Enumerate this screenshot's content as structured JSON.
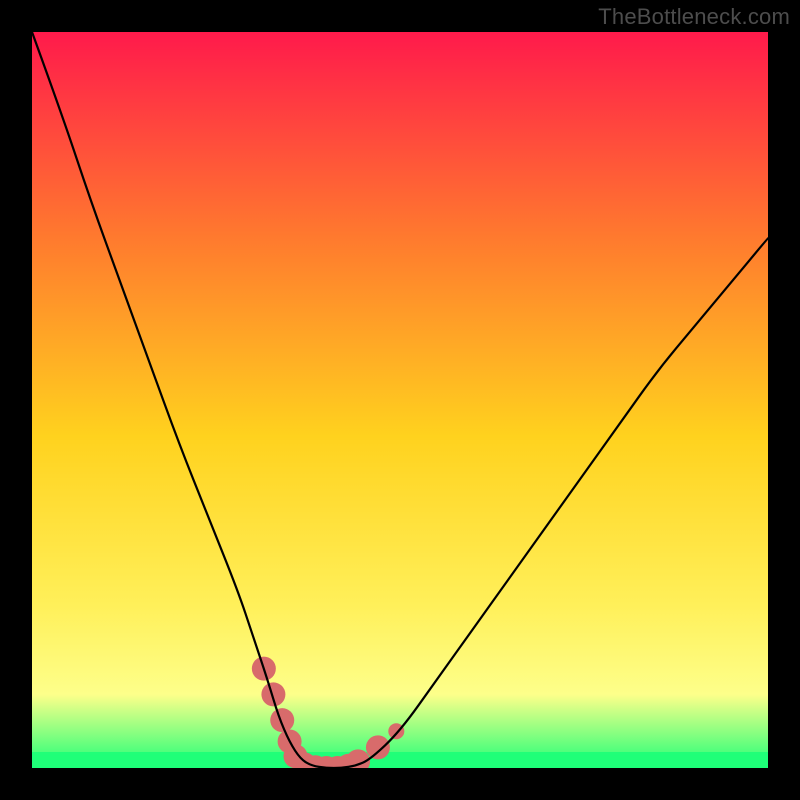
{
  "watermark": "TheBottleneck.com",
  "colors": {
    "gradient_top": "#ff1a4b",
    "gradient_mid1": "#ff7a2e",
    "gradient_mid2": "#ffd21e",
    "gradient_mid3": "#fff05a",
    "gradient_mid4": "#fdff8a",
    "gradient_bottom": "#1eff78",
    "curve": "#000000",
    "marker_fill": "#d86b6b",
    "marker_stroke": "#d86b6b"
  },
  "chart_data": {
    "type": "line",
    "title": "",
    "xlabel": "",
    "ylabel": "",
    "xlim": [
      0,
      100
    ],
    "ylim": [
      0,
      100
    ],
    "series": [
      {
        "name": "bottleneck-curve",
        "x": [
          0,
          4,
          8,
          12,
          16,
          20,
          24,
          28,
          30,
          32,
          33.5,
          35,
          36.5,
          38,
          40,
          42,
          44,
          46,
          50,
          55,
          60,
          65,
          70,
          75,
          80,
          85,
          90,
          95,
          100
        ],
        "y": [
          100,
          89,
          77,
          66,
          55,
          44,
          34,
          24,
          18,
          12,
          7,
          3.5,
          1.2,
          0.3,
          0,
          0,
          0.3,
          1.2,
          5,
          12,
          19,
          26,
          33,
          40,
          47,
          54,
          60,
          66,
          72
        ]
      }
    ],
    "markers": [
      {
        "x": 31.5,
        "y": 13.5
      },
      {
        "x": 32.8,
        "y": 10.0
      },
      {
        "x": 34.0,
        "y": 6.5
      },
      {
        "x": 35.0,
        "y": 3.6
      },
      {
        "x": 35.8,
        "y": 1.6
      },
      {
        "x": 37.0,
        "y": 0.5
      },
      {
        "x": 38.5,
        "y": 0.1
      },
      {
        "x": 40.0,
        "y": 0.0
      },
      {
        "x": 41.5,
        "y": 0.0
      },
      {
        "x": 43.0,
        "y": 0.3
      },
      {
        "x": 44.3,
        "y": 0.9
      },
      {
        "x": 47.0,
        "y": 2.8
      },
      {
        "x": 49.5,
        "y": 5.0
      }
    ]
  }
}
